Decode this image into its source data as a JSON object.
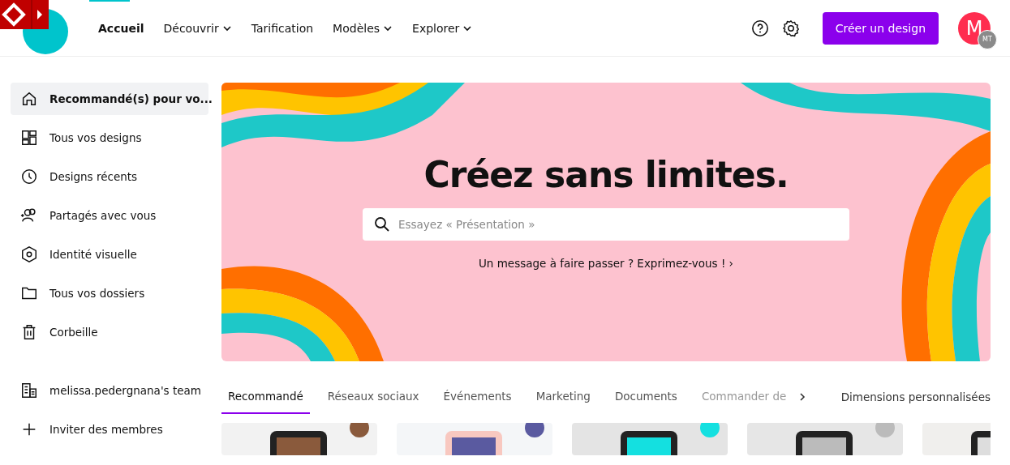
{
  "nav": [
    {
      "label": "Accueil",
      "selected": true,
      "dropdown": false
    },
    {
      "label": "Découvrir",
      "selected": false,
      "dropdown": true
    },
    {
      "label": "Tarification",
      "selected": false,
      "dropdown": false
    },
    {
      "label": "Modèles",
      "selected": false,
      "dropdown": true
    },
    {
      "label": "Explorer",
      "selected": false,
      "dropdown": true
    }
  ],
  "create_button": "Créer un design",
  "avatar": {
    "initial": "M",
    "badge": "MT"
  },
  "sidebar": [
    {
      "label": "Recommandé(s) pour vo...",
      "selected": true
    },
    {
      "label": "Tous vos designs",
      "selected": false
    },
    {
      "label": "Designs récents",
      "selected": false
    },
    {
      "label": "Partagés avec vous",
      "selected": false
    },
    {
      "label": "Identité visuelle",
      "selected": false
    },
    {
      "label": "Tous vos dossiers",
      "selected": false
    },
    {
      "label": "Corbeille",
      "selected": false
    }
  ],
  "team": [
    {
      "label": "melissa.pedergnana's team"
    },
    {
      "label": "Inviter des membres"
    }
  ],
  "hero": {
    "title": "Créez sans limites.",
    "search_placeholder": "Essayez « Présentation »",
    "link": "Un message à faire passer ? Exprimez-vous ! ›"
  },
  "tabs": [
    {
      "label": "Recommandé",
      "selected": true,
      "faded": false
    },
    {
      "label": "Réseaux sociaux",
      "selected": false,
      "faded": false
    },
    {
      "label": "Événements",
      "selected": false,
      "faded": false
    },
    {
      "label": "Marketing",
      "selected": false,
      "faded": false
    },
    {
      "label": "Documents",
      "selected": false,
      "faded": false
    },
    {
      "label": "Commander de",
      "selected": false,
      "faded": true
    }
  ],
  "custom_size": "Dimensions personnalisées"
}
